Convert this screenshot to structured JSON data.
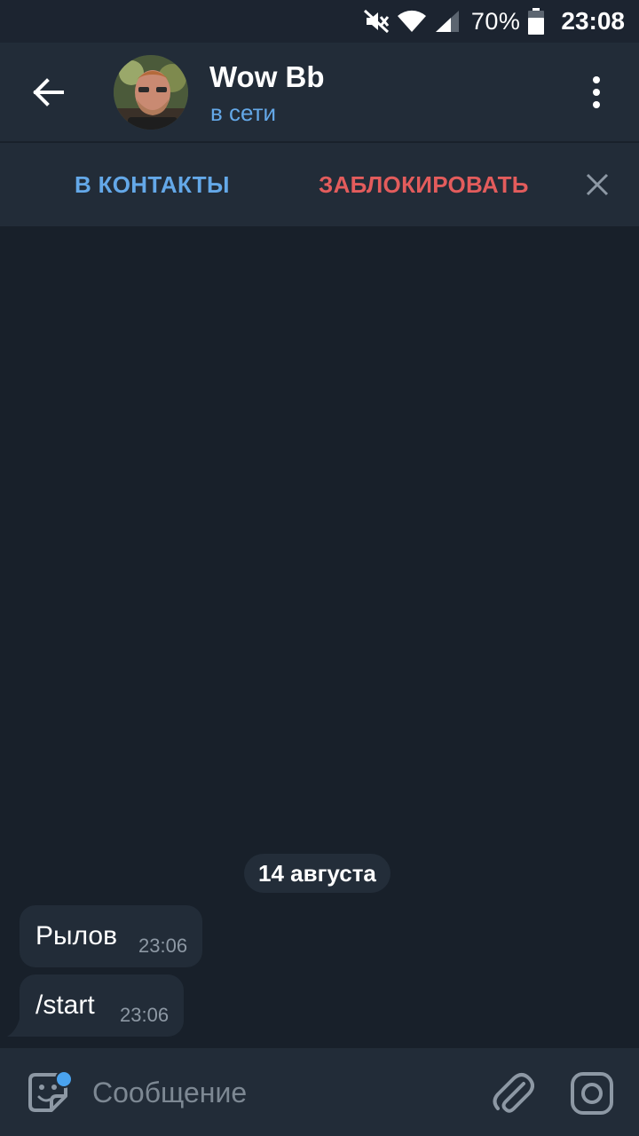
{
  "status_bar": {
    "icons": [
      "mute-icon",
      "wifi-icon",
      "signal-icon",
      "battery-icon"
    ],
    "battery": "70%",
    "time": "23:08"
  },
  "header": {
    "back_icon": "arrow-left-icon",
    "name": "Wow Bb",
    "status": "в сети",
    "menu_icon": "more-vertical-icon"
  },
  "action_bar": {
    "add_contact": "В КОНТАКТЫ",
    "block": "ЗАБЛОКИРОВАТЬ",
    "close_icon": "close-icon"
  },
  "chat": {
    "date": "14 августа",
    "messages": [
      {
        "text": "Рылов",
        "time": "23:06"
      },
      {
        "text": "/start",
        "time": "23:06"
      }
    ]
  },
  "input": {
    "placeholder": "Сообщение",
    "value": "",
    "icons": [
      "sticker-icon",
      "attach-icon",
      "camera-icon"
    ]
  },
  "colors": {
    "background": "#18202a",
    "panel": "#222c38",
    "accent_blue": "#64a8e8",
    "danger_red": "#e35c5c"
  }
}
